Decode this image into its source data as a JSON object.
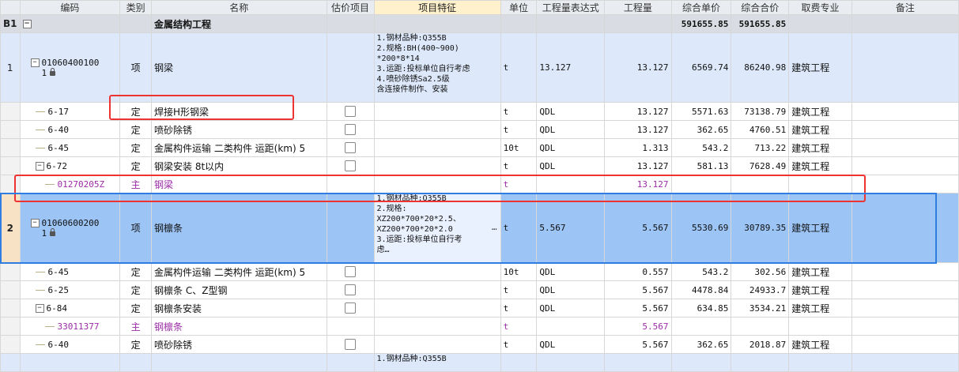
{
  "columns": [
    "编码",
    "类别",
    "名称",
    "估价项目",
    "项目特征",
    "单位",
    "工程量表达式",
    "工程量",
    "综合单价",
    "综合合价",
    "取费专业",
    "备注"
  ],
  "section": {
    "row_no": "B1",
    "collapse": "−",
    "name": "金属结构工程",
    "unit_price": "591655.85",
    "total": "591655.85"
  },
  "item1": {
    "row_no": "1",
    "code_line1": "01060400100",
    "code_line2": "1",
    "type": "项",
    "name": "钢梁",
    "features": [
      "1.钢材品种:Q355B",
      "2.规格:BH(400~900)",
      "*200*8*14",
      "3.运距:投标单位自行考虑",
      "4.喷砂除锈Sa2.5级",
      "含连接件制作、安装"
    ],
    "unit": "t",
    "expr": "13.127",
    "qty": "13.127",
    "unit_price": "6569.74",
    "total": "86240.98",
    "fee": "建筑工程"
  },
  "sub1": [
    {
      "code": "6-17",
      "type": "定",
      "name": "焊接H形钢梁",
      "unit": "t",
      "expr": "QDL",
      "qty": "13.127",
      "unit_price": "5571.63",
      "total": "73138.79",
      "fee": "建筑工程"
    },
    {
      "code": "6-40",
      "type": "定",
      "name": "喷砂除锈",
      "unit": "t",
      "expr": "QDL",
      "qty": "13.127",
      "unit_price": "362.65",
      "total": "4760.51",
      "fee": "建筑工程"
    },
    {
      "code": "6-45",
      "type": "定",
      "name": "金属构件运输 二类构件 运距(km) 5",
      "unit": "10t",
      "expr": "QDL",
      "qty": "1.313",
      "unit_price": "543.2",
      "total": "713.22",
      "fee": "建筑工程"
    },
    {
      "code": "6-72",
      "type": "定",
      "name": "钢梁安装 8t以内",
      "unit": "t",
      "expr": "QDL",
      "qty": "13.127",
      "unit_price": "581.13",
      "total": "7628.49",
      "fee": "建筑工程"
    }
  ],
  "main1": {
    "code": "01270205Z",
    "type": "主",
    "name": "钢梁",
    "unit": "t",
    "qty": "13.127"
  },
  "item2": {
    "row_no": "2",
    "code_line1": "01060600200",
    "code_line2": "1",
    "type": "项",
    "name": "钢檩条",
    "features": [
      "1.钢材品种:Q355B",
      "2.规格:",
      "XZ200*700*20*2.5、",
      "XZ200*700*20*2.0",
      "3.运距:投标单位自行考",
      "虑…"
    ],
    "ellipsis": "…",
    "unit": "t",
    "expr": "5.567",
    "qty": "5.567",
    "unit_price": "5530.69",
    "total": "30789.35",
    "fee": "建筑工程"
  },
  "sub2": [
    {
      "code": "6-45",
      "type": "定",
      "name": "金属构件运输 二类构件 运距(km) 5",
      "unit": "10t",
      "expr": "QDL",
      "qty": "0.557",
      "unit_price": "543.2",
      "total": "302.56",
      "fee": "建筑工程"
    },
    {
      "code": "6-25",
      "type": "定",
      "name": "钢檩条 C、Z型钢",
      "unit": "t",
      "expr": "QDL",
      "qty": "5.567",
      "unit_price": "4478.84",
      "total": "24933.7",
      "fee": "建筑工程"
    },
    {
      "code": "6-84",
      "type": "定",
      "name": "钢檩条安装",
      "unit": "t",
      "expr": "QDL",
      "qty": "5.567",
      "unit_price": "634.85",
      "total": "3534.21",
      "fee": "建筑工程"
    }
  ],
  "main2": {
    "code": "33011377",
    "type": "主",
    "name": "钢檩条",
    "unit": "t",
    "qty": "5.567"
  },
  "last": {
    "code": "6-40",
    "type": "定",
    "name": "喷砂除锈",
    "unit": "t",
    "expr": "QDL",
    "qty": "5.567",
    "unit_price": "362.65",
    "total": "2018.87",
    "fee": "建筑工程"
  },
  "next_feature_hint": "1.钢材品种:Q355B",
  "colors": {
    "highlight": "#e33333",
    "selection": "#2f7de1",
    "main_material": "#9b2ca6"
  }
}
